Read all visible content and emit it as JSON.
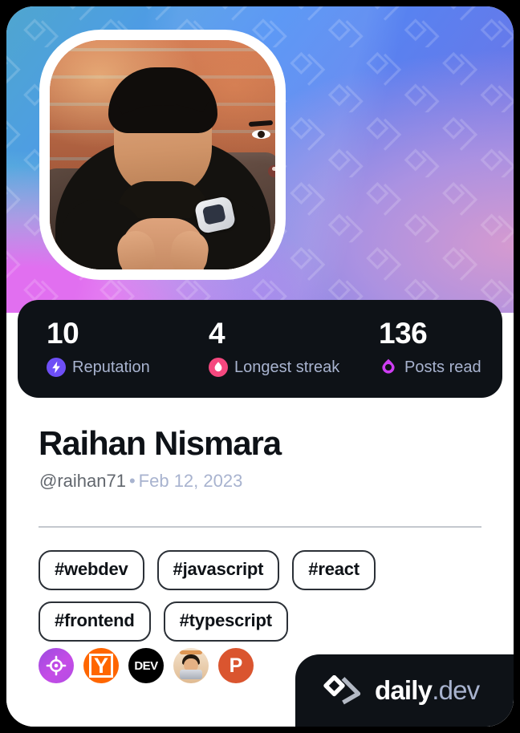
{
  "card": {
    "type": "devcard",
    "background_color": "#000000",
    "card_background": "#FFFFFF",
    "dark_panel_color": "#0E1217"
  },
  "cover": {
    "watermark_icon": "daily-dev-mark",
    "gradient_colors": [
      "#4fa6cf",
      "#4b8df4",
      "#7c74df",
      "#e16ff0",
      "#7fd9d2"
    ]
  },
  "avatar": {
    "alt": "Raihan Nismara profile photo",
    "frame_color": "#FFFFFF"
  },
  "stats": [
    {
      "value": "10",
      "label": "Reputation",
      "icon": "reputation-bolt-icon",
      "color": "#6E4FF6"
    },
    {
      "value": "4",
      "label": "Longest streak",
      "icon": "streak-flame-icon",
      "color": "#F5487F"
    },
    {
      "value": "136",
      "label": "Posts read",
      "icon": "posts-read-eye-icon",
      "color": "#CE3DF3"
    }
  ],
  "profile": {
    "name": "Raihan Nismara",
    "handle": "@raihan71",
    "separator": "•",
    "joined": "Feb 12, 2023"
  },
  "tags": [
    "#webdev",
    "#javascript",
    "#react",
    "#frontend",
    "#typescript"
  ],
  "sources": [
    {
      "name": "target-source-icon",
      "label": ""
    },
    {
      "name": "ycombinator-source-icon",
      "label": "Y"
    },
    {
      "name": "devto-source-icon",
      "label": "DEV"
    },
    {
      "name": "avatar-source-icon",
      "label": ""
    },
    {
      "name": "producthunt-source-icon",
      "label": "P"
    }
  ],
  "brand": {
    "icon": "daily-dev-logo-icon",
    "name": "daily",
    "suffix": ".dev"
  }
}
